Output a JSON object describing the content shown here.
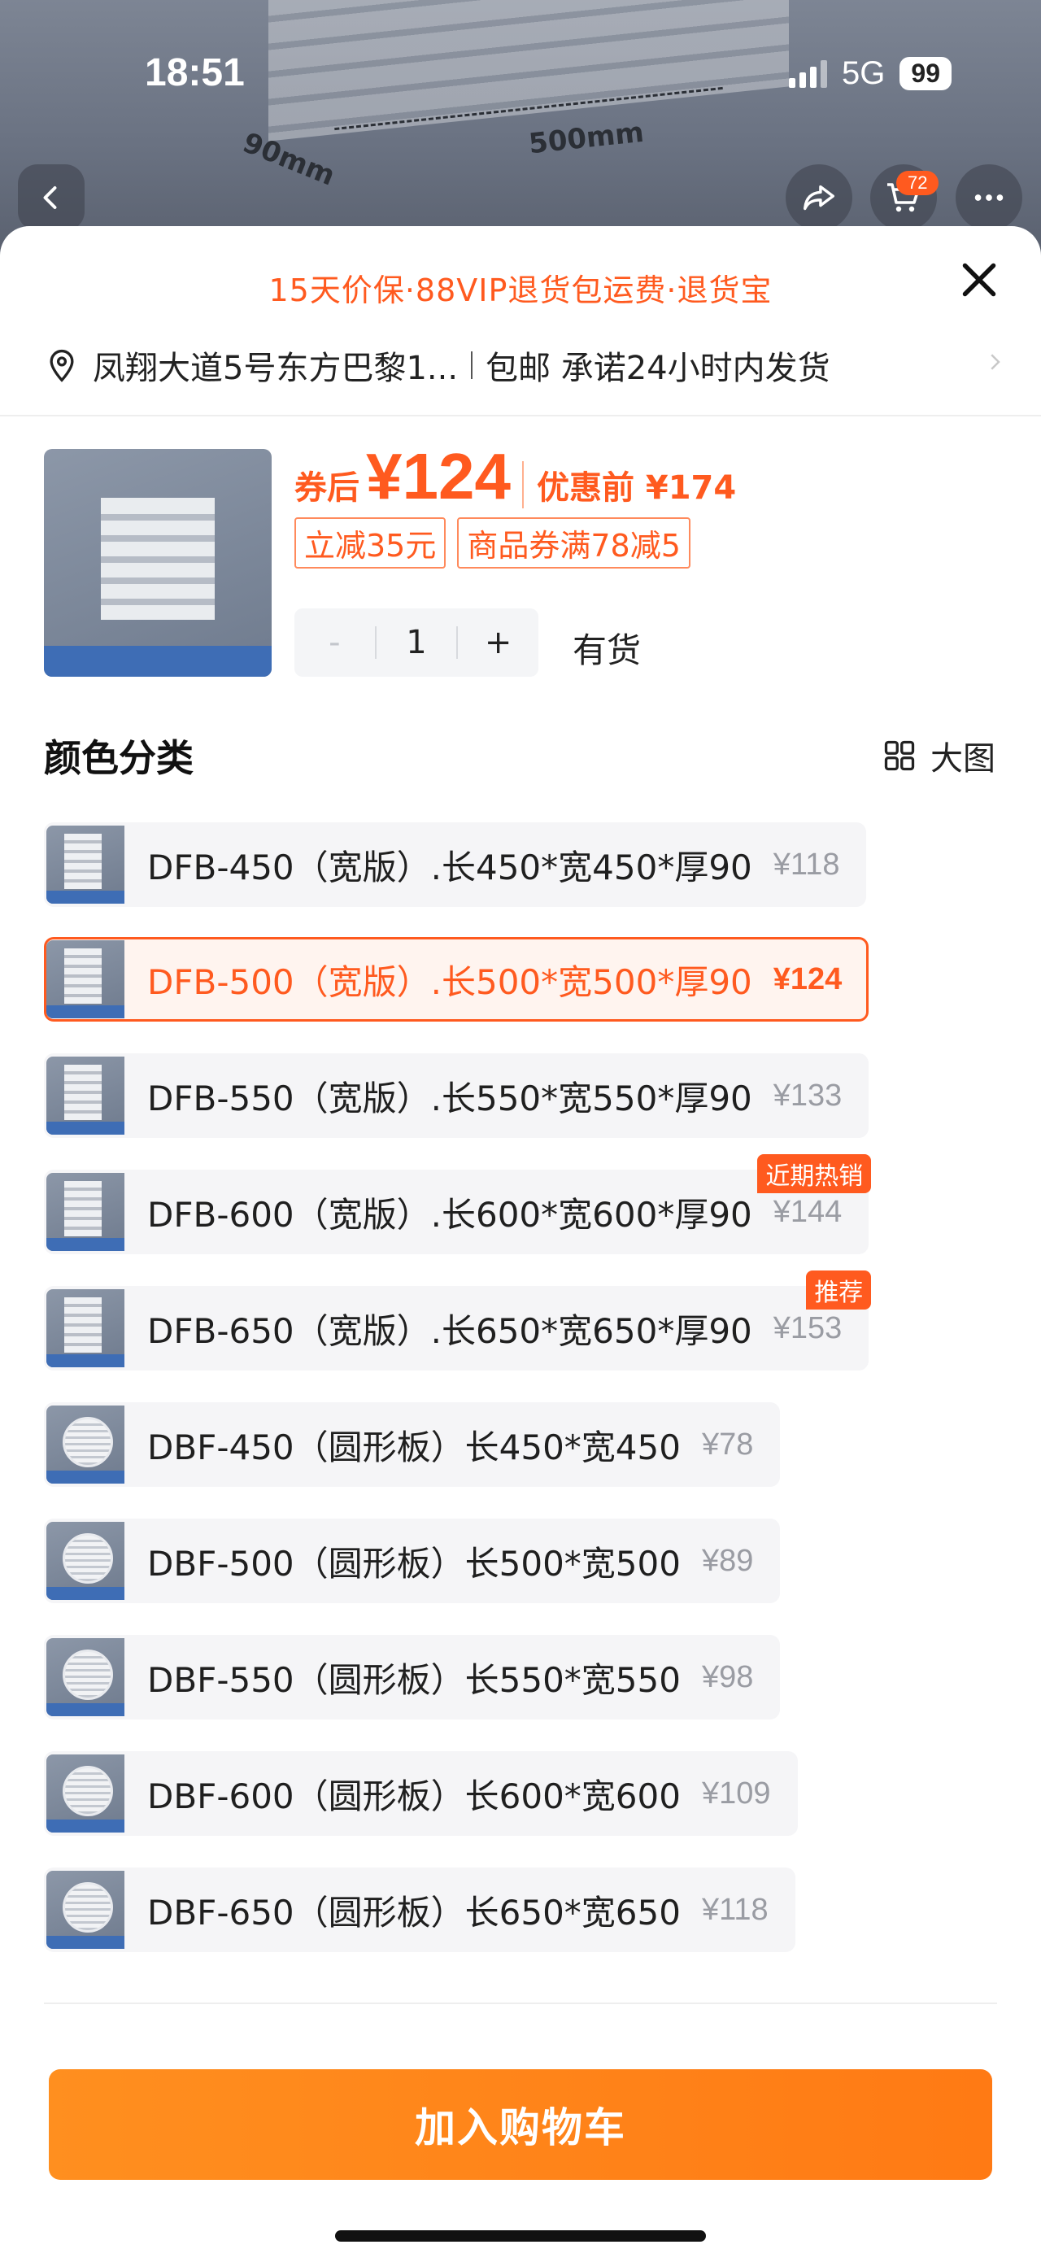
{
  "status_bar": {
    "time": "18:51",
    "network": "5G",
    "battery": "99"
  },
  "header": {
    "cart_badge": "72",
    "image_dims": {
      "width": "500mm",
      "depth": "90mm"
    }
  },
  "sheet": {
    "promo": "15天价保·88VIP退货包运费·退货宝",
    "address": "凤翔大道5号东方巴黎1...",
    "shipping": "包邮 承诺24小时内发货"
  },
  "product": {
    "price_after_label": "券后",
    "price_after": "¥124",
    "price_before": "优惠前 ¥174",
    "coupons": [
      "立减35元",
      "商品券满78减5"
    ],
    "quantity": "1",
    "stepper_minus": "-",
    "stepper_plus": "+",
    "stock": "有货"
  },
  "variants_section": {
    "title": "颜色分类",
    "big_view_label": "大图"
  },
  "variants": [
    {
      "label": "DFB-450（宽版）.长450*宽450*厚90",
      "price": "¥118"
    },
    {
      "label": "DFB-500（宽版）.长500*宽500*厚90",
      "price": "¥124"
    },
    {
      "label": "DFB-550（宽版）.长550*宽550*厚90",
      "price": "¥133"
    },
    {
      "label": "DFB-600（宽版）.长600*宽600*厚90",
      "price": "¥144",
      "tag": "近期热销"
    },
    {
      "label": "DFB-650（宽版）.长650*宽650*厚90",
      "price": "¥153",
      "tag": "推荐"
    },
    {
      "label": "DBF-450（圆形板）长450*宽450",
      "price": "¥78"
    },
    {
      "label": "DBF-500（圆形板）长500*宽500",
      "price": "¥89"
    },
    {
      "label": "DBF-550（圆形板）长550*宽550",
      "price": "¥98"
    },
    {
      "label": "DBF-600（圆形板）长600*宽600",
      "price": "¥109"
    },
    {
      "label": "DBF-650（圆形板）长650*宽650",
      "price": "¥118"
    }
  ],
  "selected_variant": "DFB-500（宽版）.长500*宽500*厚90",
  "footer": {
    "add_to_cart": "加入购物车"
  },
  "colors": {
    "accent": "#ff5a1f",
    "cta": "#ff7a14"
  }
}
